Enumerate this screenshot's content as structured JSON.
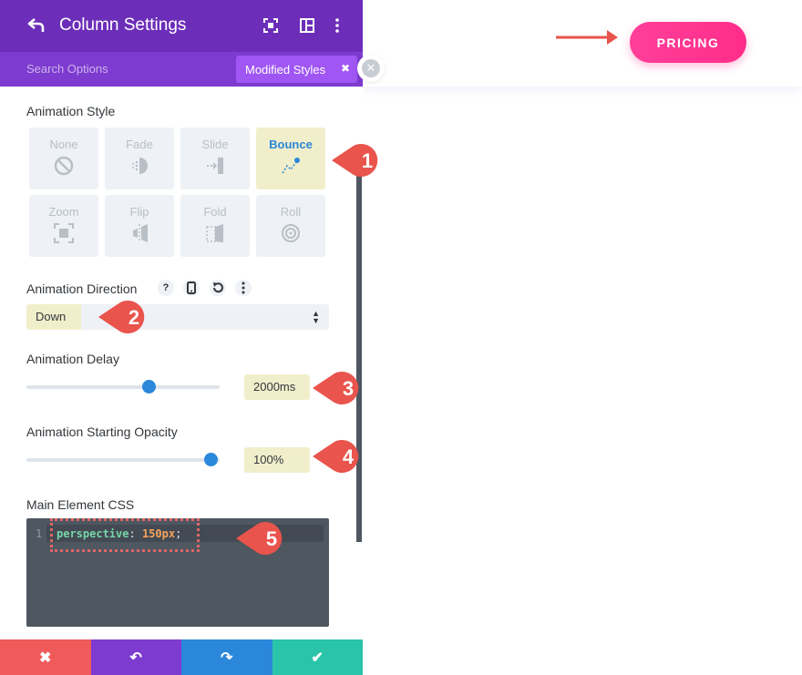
{
  "panel": {
    "title": "Column Settings",
    "search_placeholder": "Search Options",
    "modified_styles_label": "Modified Styles",
    "modified_close": "✖"
  },
  "animation_style": {
    "label": "Animation Style",
    "options": [
      {
        "label": "None",
        "icon": "none-icon"
      },
      {
        "label": "Fade",
        "icon": "fade-icon"
      },
      {
        "label": "Slide",
        "icon": "slide-icon"
      },
      {
        "label": "Bounce",
        "icon": "bounce-icon",
        "selected": true
      },
      {
        "label": "Zoom",
        "icon": "zoom-icon"
      },
      {
        "label": "Flip",
        "icon": "flip-icon"
      },
      {
        "label": "Fold",
        "icon": "fold-icon"
      },
      {
        "label": "Roll",
        "icon": "roll-icon"
      }
    ]
  },
  "animation_direction": {
    "label": "Animation Direction",
    "help": "?",
    "value": "Down"
  },
  "animation_delay": {
    "label": "Animation Delay",
    "value": "2000ms",
    "slider_level": 0.65
  },
  "starting_opacity": {
    "label": "Animation Starting Opacity",
    "value": "100%",
    "slider_level": 1.0
  },
  "css": {
    "label": "Main Element CSS",
    "line_number": "1",
    "property": "perspective",
    "colon": ": ",
    "value": "150px",
    "semicolon": ";"
  },
  "footer": {
    "cancel": "✖",
    "undo": "↶",
    "redo": "↷",
    "save": "✔"
  },
  "page": {
    "pricing_button": "PRICING"
  },
  "callouts": [
    "1",
    "2",
    "3",
    "4",
    "5"
  ],
  "colors": {
    "header_purple": "#6c2eb9",
    "search_purple": "#7d3bcf",
    "modified_pill": "#a056f2",
    "accent_blue": "#2b87da",
    "highlight_yellow": "#f1eecb",
    "cancel_red": "#ef5a5a",
    "undo_purple": "#7e3bd0",
    "redo_blue": "#2b87da",
    "save_green": "#29c4a9",
    "pricing_pink": "#ff3f9a",
    "callout_red": "#e9544c"
  }
}
